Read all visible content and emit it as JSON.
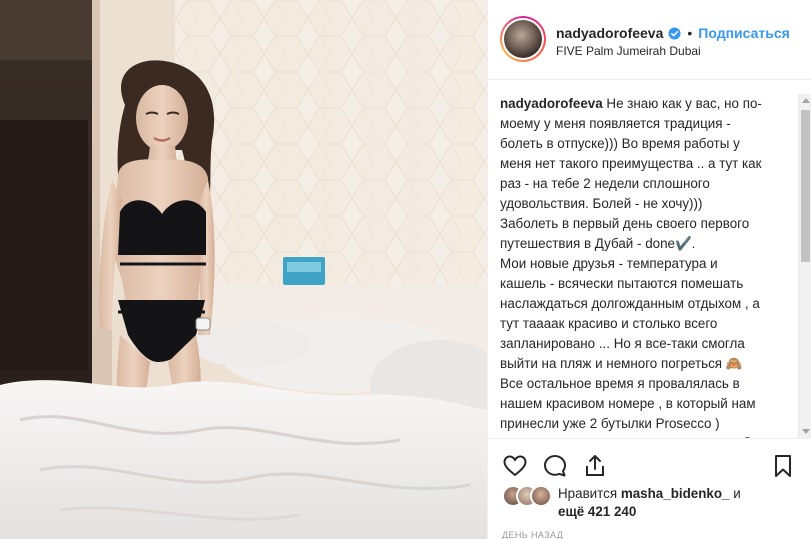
{
  "post": {
    "username": "nadyadorofeeva",
    "separator": "•",
    "follow_label": "Подписаться",
    "location": "FIVE Palm Jumeirah Dubai",
    "verified_icon": "verified-badge-icon"
  },
  "caption": {
    "username": "nadyadorofeeva",
    "text": " Не знаю как у вас, но по-\nмоему у меня появляется традиция -\nболеть в отпуске))) Во время работы у\nменя нет такого преимущества .. а тут как\nраз - на тебе 2 недели сплошного\nудовольствия. Болей - не хочу)))\nЗаболеть в первый день своего первого\nпутешествия в Дубай - done✔️.\nМои новые друзья - температура и\nкашель - всячески пытаются помешать\nнаслаждаться долгожданным отдыхом , а\nтут таааак красиво и столько всего\nзапланировано ... Но я все-таки смогла\nвыйти на пляж и немного погреться 🙈\nВсе остальное время я провалялась в\nнашем красивом номере , в который нам\nпринесли уже 2 бутылки Prosecco )\nВидимо думают , что мы молодожёны 😳\n😂"
  },
  "actions": {
    "like_icon": "heart-icon",
    "comment_icon": "comment-icon",
    "share_icon": "share-icon",
    "save_icon": "bookmark-icon"
  },
  "likes": {
    "prefix": "Нравится",
    "user": "masha_bidenko_",
    "middle": " и",
    "count_text": "ещё 421 240"
  },
  "timestamp": "ДЕНЬ НАЗАД",
  "colors": {
    "accent": "#3897f0",
    "text": "#262626",
    "muted": "#999999",
    "border": "#efefef"
  }
}
